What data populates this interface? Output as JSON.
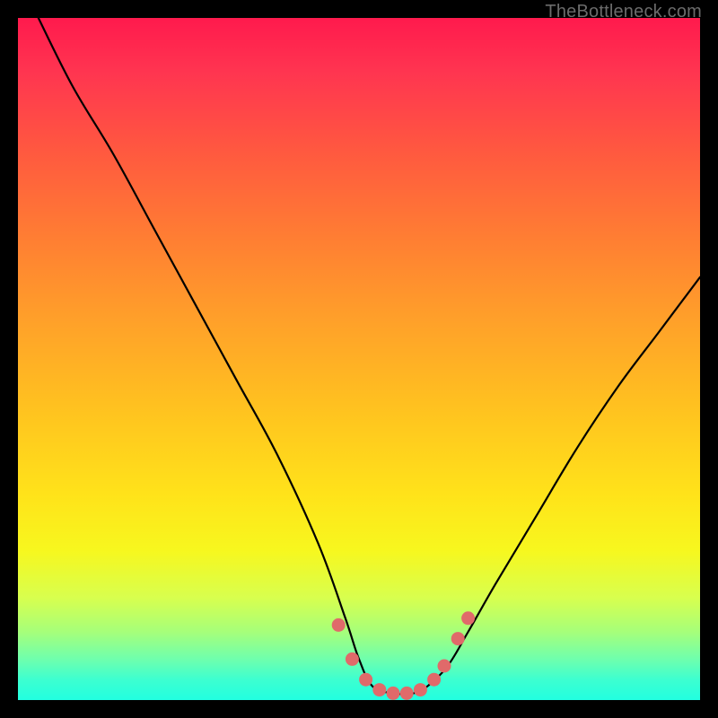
{
  "watermark": "TheBottleneck.com",
  "chart_data": {
    "type": "line",
    "title": "",
    "xlabel": "",
    "ylabel": "",
    "xlim": [
      0,
      100
    ],
    "ylim": [
      0,
      100
    ],
    "series": [
      {
        "name": "bottleneck-curve",
        "x": [
          3,
          8,
          14,
          20,
          26,
          32,
          38,
          44,
          48,
          50,
          52,
          55,
          58,
          60,
          63,
          66,
          70,
          76,
          82,
          88,
          94,
          100
        ],
        "y": [
          100,
          90,
          80,
          69,
          58,
          47,
          36,
          23,
          12,
          6,
          2,
          1,
          1,
          2,
          5,
          10,
          17,
          27,
          37,
          46,
          54,
          62
        ]
      }
    ],
    "dots": {
      "name": "highlight-dots",
      "color": "#e06a6a",
      "points": [
        {
          "x": 47,
          "y": 11
        },
        {
          "x": 49,
          "y": 6
        },
        {
          "x": 51,
          "y": 3
        },
        {
          "x": 53,
          "y": 1.5
        },
        {
          "x": 55,
          "y": 1
        },
        {
          "x": 57,
          "y": 1
        },
        {
          "x": 59,
          "y": 1.5
        },
        {
          "x": 61,
          "y": 3
        },
        {
          "x": 62.5,
          "y": 5
        },
        {
          "x": 64.5,
          "y": 9
        },
        {
          "x": 66,
          "y": 12
        }
      ]
    }
  }
}
